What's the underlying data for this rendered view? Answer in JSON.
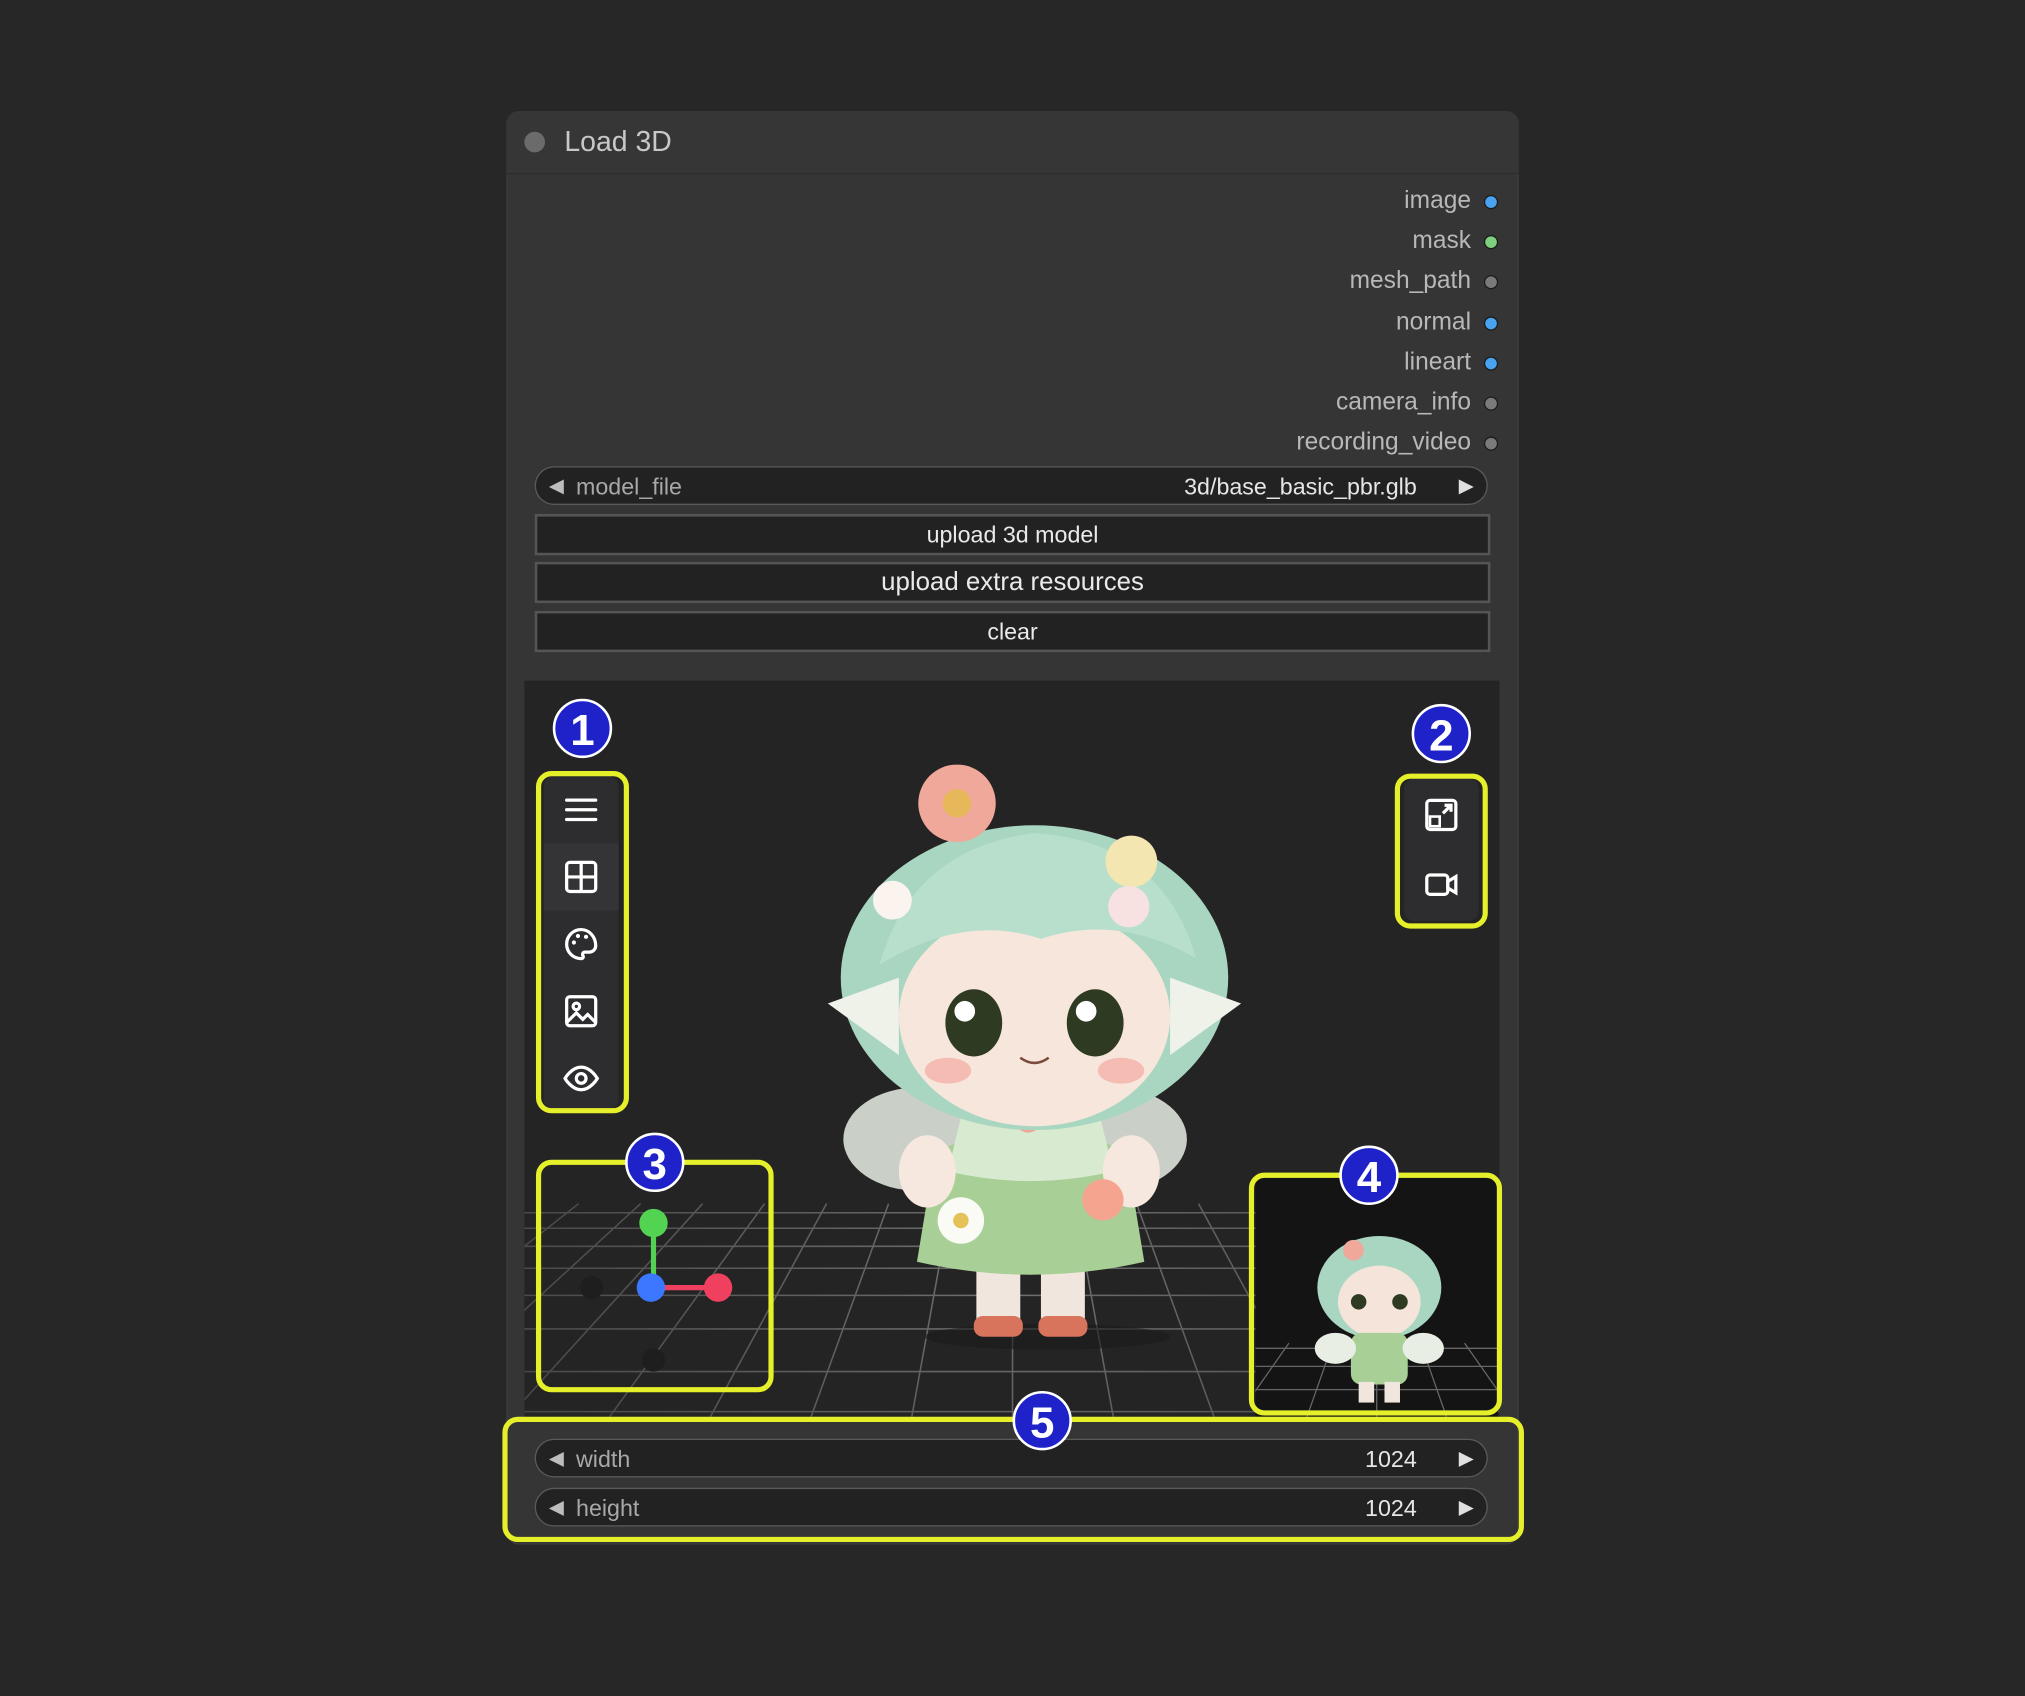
{
  "node": {
    "title": "Load 3D"
  },
  "outputs": [
    {
      "label": "image",
      "color": "#4aa3f0"
    },
    {
      "label": "mask",
      "color": "#7ed07e"
    },
    {
      "label": "mesh_path",
      "color": "#7a7a7a"
    },
    {
      "label": "normal",
      "color": "#4aa3f0"
    },
    {
      "label": "lineart",
      "color": "#4aa3f0"
    },
    {
      "label": "camera_info",
      "color": "#7a7a7a"
    },
    {
      "label": "recording_video",
      "color": "#7a7a7a"
    }
  ],
  "model_file": {
    "label": "model_file",
    "value": "3d/base_basic_pbr.glb"
  },
  "buttons": {
    "upload_model": "upload 3d model",
    "upload_extra": "upload extra resources",
    "clear": "clear"
  },
  "toolbar": {
    "items": [
      "menu-icon",
      "grid-icon",
      "palette-icon",
      "image-icon",
      "eye-icon"
    ]
  },
  "view_controls": [
    "fullscreen-icon",
    "record-video-icon"
  ],
  "dimensions": {
    "width": {
      "label": "width",
      "value": "1024"
    },
    "height": {
      "label": "height",
      "value": "1024"
    }
  },
  "annotations": {
    "b1": "1",
    "b2": "2",
    "b3": "3",
    "b4": "4",
    "b5": "5",
    "highlight_color": "#e6f02a",
    "badge_color": "#1e22c8"
  }
}
